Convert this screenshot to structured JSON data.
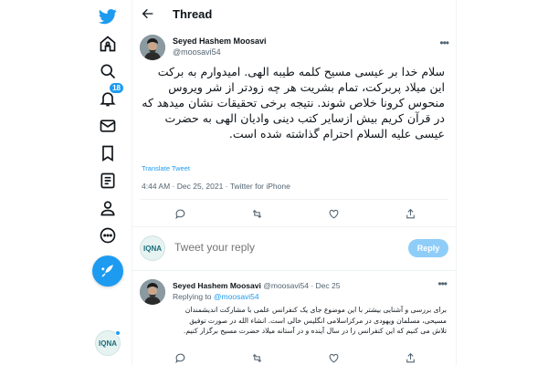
{
  "colors": {
    "accent": "#1d9bf0",
    "text": "#0f1419",
    "muted": "#536471",
    "reply_btn": "#8ecdf8"
  },
  "sidebar": {
    "items": [
      {
        "icon": "twitter-logo-icon"
      },
      {
        "icon": "home-icon"
      },
      {
        "icon": "explore-icon"
      },
      {
        "icon": "notifications-icon",
        "badge": "18"
      },
      {
        "icon": "messages-icon"
      },
      {
        "icon": "bookmarks-icon"
      },
      {
        "icon": "lists-icon"
      },
      {
        "icon": "profile-icon"
      },
      {
        "icon": "more-icon"
      }
    ],
    "compose_icon": "compose-tweet-icon",
    "account_avatar_text": "IQNA"
  },
  "header": {
    "title": "Thread"
  },
  "tweet": {
    "author_name": "Seyed Hashem Moosavi",
    "author_handle": "@moosavi54",
    "text": "سلام خدا بر عیسی مسیح کلمه طیبه الهی. امیدوارم به برکت این میلاد پربرکت، تمام بشریت هر چه زودتر از شر ویروس منحوس کرونا خلاص شوند. نتیجه برخی تحقیقات نشان میدهد که در قرآن کریم بیش ازسایر کتب دینی وادیان الهی به حضرت عیسی علیه السلام احترام گذاشته شده است.",
    "translate_label": "Translate Tweet",
    "meta": "4:44 AM · Dec 25, 2021 · Twitter for iPhone"
  },
  "reply_box": {
    "placeholder": "Tweet your reply",
    "button_label": "Reply",
    "avatar_text": "IQNA"
  },
  "reply_tweet": {
    "author_name": "Seyed Hashem Moosavi",
    "handle_date": "@moosavi54 · Dec 25",
    "replying_prefix": "Replying to",
    "replying_handle": "@moosavi54",
    "text": "برای بررسی و آشنایی بیشتر با این موضوع  جای یک کنفرانس علمی با مشارکت اندیشمندان مسیحی، مسلمان ویهودی در مرکزاسلامی انگلیس خالی است. انشاء الله در صورت توفیق تلاش می کنیم که این  کنفرانس را در سال آینده و در آستانه میلاد حضرت مسیح برگزار کنیم."
  }
}
